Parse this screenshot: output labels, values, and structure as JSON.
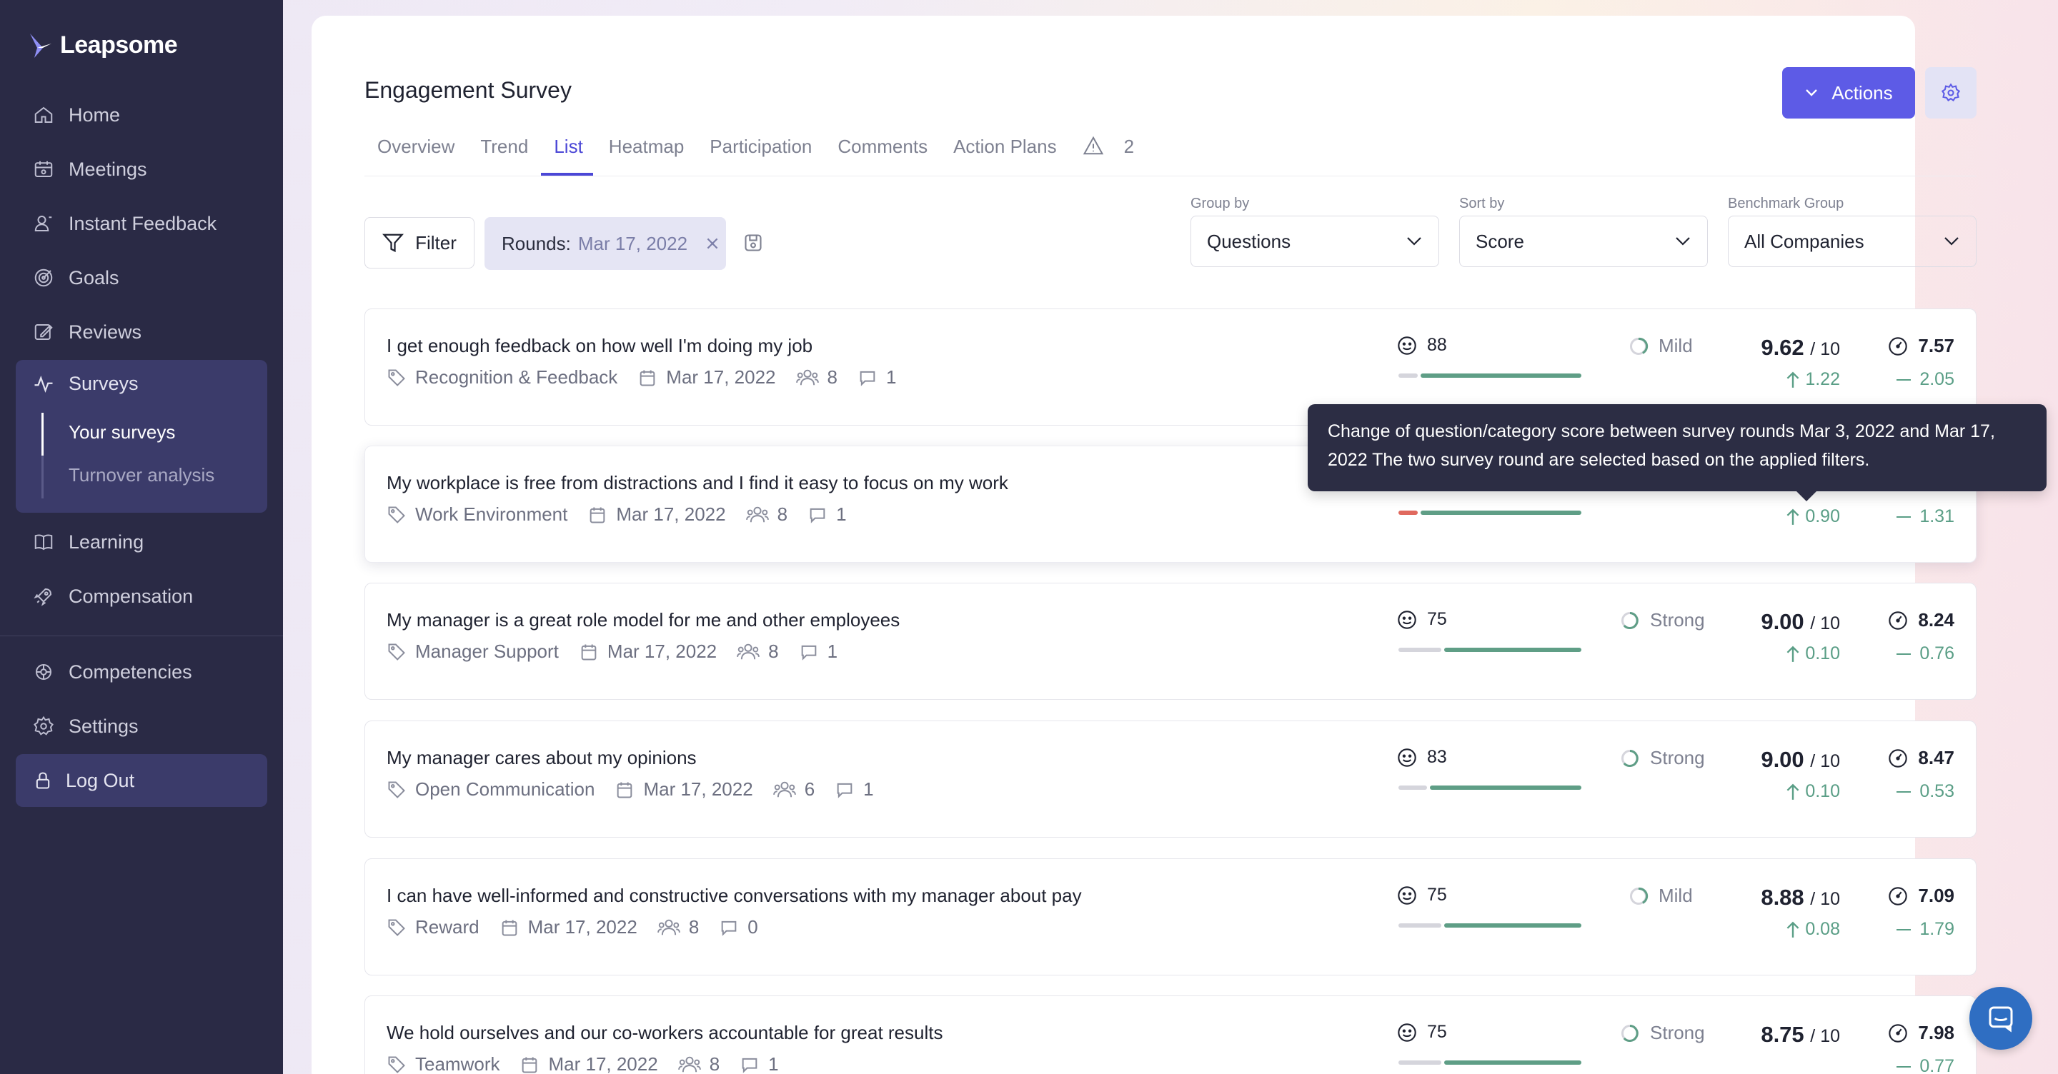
{
  "brand": {
    "name": "Leapsome"
  },
  "sidebar": {
    "items": [
      {
        "label": "Home",
        "icon": "home-icon"
      },
      {
        "label": "Meetings",
        "icon": "meetings-icon"
      },
      {
        "label": "Instant Feedback",
        "icon": "feedback-icon"
      },
      {
        "label": "Goals",
        "icon": "goals-icon"
      },
      {
        "label": "Reviews",
        "icon": "reviews-icon"
      }
    ],
    "surveys": {
      "label": "Surveys",
      "sub": [
        "Your surveys",
        "Turnover analysis"
      ]
    },
    "items2": [
      {
        "label": "Learning",
        "icon": "book-icon"
      },
      {
        "label": "Compensation",
        "icon": "rocket-icon"
      }
    ],
    "items3": [
      {
        "label": "Competencies",
        "icon": "competencies-icon"
      },
      {
        "label": "Settings",
        "icon": "gear-icon"
      }
    ],
    "logout": "Log Out"
  },
  "header": {
    "title": "Engagement Survey",
    "actions_label": "Actions",
    "tabs": [
      "Overview",
      "Trend",
      "List",
      "Heatmap",
      "Participation",
      "Comments",
      "Action Plans"
    ],
    "active_tab": "List",
    "warning_count": "2"
  },
  "toolbar": {
    "filter_label": "Filter",
    "rounds_label": "Rounds:",
    "rounds_value": "Mar 17, 2022",
    "group_by": {
      "label": "Group by",
      "value": "Questions"
    },
    "sort_by": {
      "label": "Sort by",
      "value": "Score"
    },
    "benchmark": {
      "label": "Benchmark Group",
      "value": "All Companies"
    }
  },
  "rows": [
    {
      "question": "I get enough feedback on how well I'm doing my job",
      "category": "Recognition & Feedback",
      "date": "Mar 17, 2022",
      "participants": "8",
      "comments": "1",
      "favorability": "88",
      "neg_share": 0.12,
      "strength": "Mild",
      "score": "9.62",
      "score_den": "/ 10",
      "delta": "1.22",
      "benchmark": "7.57",
      "bench_delta": "2.05"
    },
    {
      "question": "My workplace is free from distractions and I find it easy to focus on my work",
      "category": "Work Environment",
      "date": "Mar 17, 2022",
      "participants": "8",
      "comments": "1",
      "favorability": "",
      "neg_share": 0.12,
      "strength": "",
      "score": "",
      "score_den": "",
      "delta": "0.90",
      "benchmark": "",
      "bench_delta": "1.31"
    },
    {
      "question": "My manager is a great role model for me and other employees",
      "category": "Manager Support",
      "date": "Mar 17, 2022",
      "participants": "8",
      "comments": "1",
      "favorability": "75",
      "neg_share": 0.25,
      "strength": "Strong",
      "score": "9.00",
      "score_den": "/ 10",
      "delta": "0.10",
      "benchmark": "8.24",
      "bench_delta": "0.76"
    },
    {
      "question": "My manager cares about my opinions",
      "category": "Open Communication",
      "date": "Mar 17, 2022",
      "participants": "6",
      "comments": "1",
      "favorability": "83",
      "neg_share": 0.17,
      "strength": "Strong",
      "score": "9.00",
      "score_den": "/ 10",
      "delta": "0.10",
      "benchmark": "8.47",
      "bench_delta": "0.53"
    },
    {
      "question": "I can have well-informed and constructive conversations with my manager about pay",
      "category": "Reward",
      "date": "Mar 17, 2022",
      "participants": "8",
      "comments": "0",
      "favorability": "75",
      "neg_share": 0.25,
      "strength": "Mild",
      "score": "8.88",
      "score_den": "/ 10",
      "delta": "0.08",
      "benchmark": "7.09",
      "bench_delta": "1.79"
    },
    {
      "question": "We hold ourselves and our co-workers accountable for great results",
      "category": "Teamwork",
      "date": "Mar 17, 2022",
      "participants": "8",
      "comments": "1",
      "favorability": "75",
      "neg_share": 0.25,
      "strength": "Strong",
      "score": "8.75",
      "score_den": "/ 10",
      "delta": "",
      "benchmark": "7.98",
      "bench_delta": "0.77"
    }
  ],
  "tooltip": {
    "text": "Change of question/category score between survey rounds Mar 3, 2022 and Mar 17, 2022 The two survey round are selected based on the applied filters."
  },
  "colors": {
    "sidebar_bg": "#2a2a45",
    "accent": "#5d5be6",
    "positive": "#5f9e86",
    "negative": "#e0695e"
  }
}
